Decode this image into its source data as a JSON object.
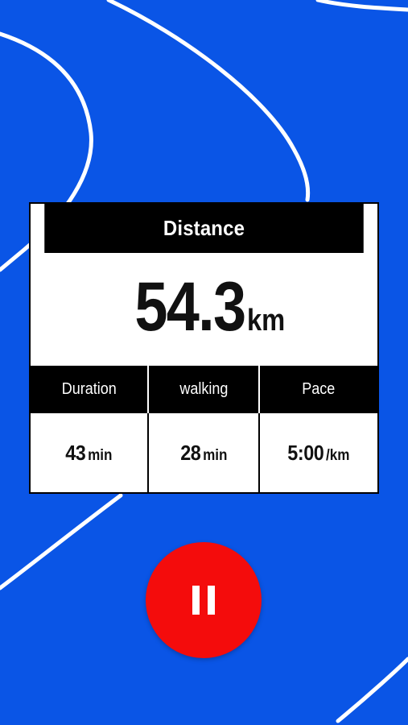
{
  "colors": {
    "background": "#0a55e6",
    "card_header": "#000000",
    "card_body": "#ffffff",
    "pause_button": "#f40c0c"
  },
  "distance": {
    "label": "Distance",
    "value": "54.3",
    "unit": "km"
  },
  "stats": [
    {
      "label": "Duration",
      "value": "43",
      "unit": "min"
    },
    {
      "label": "walking",
      "value": "28",
      "unit": "min"
    },
    {
      "label": "Pace",
      "value": "5:00",
      "unit": "/km"
    }
  ],
  "controls": {
    "pause_icon": "pause-icon"
  }
}
